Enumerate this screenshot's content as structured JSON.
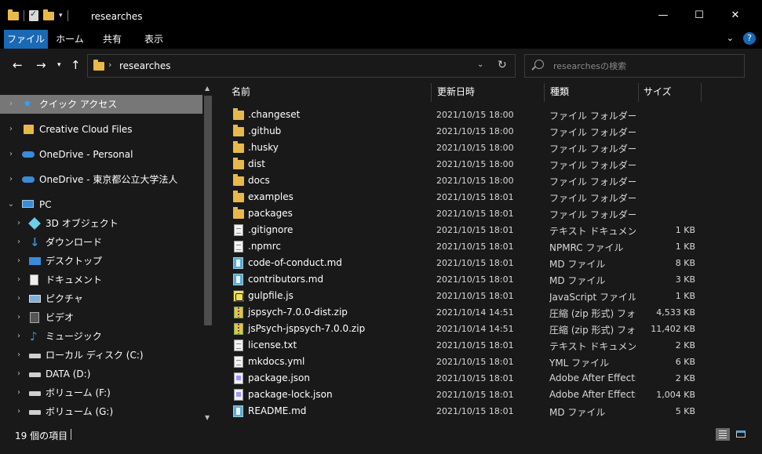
{
  "window": {
    "title": "researches",
    "controls": {
      "minimize": "—",
      "maximize": "☐",
      "close": "✕"
    }
  },
  "ribbon": {
    "tabs": [
      "ファイル",
      "ホーム",
      "共有",
      "表示"
    ],
    "help": "?"
  },
  "address": {
    "crumb": "researches"
  },
  "search": {
    "placeholder": "researchesの検索"
  },
  "nav": {
    "items": [
      {
        "label": "クイック アクセス",
        "icon": "star-icon",
        "selected": true
      },
      {
        "label": "Creative Cloud Files",
        "icon": "creative-cloud-icon"
      },
      {
        "label": "OneDrive - Personal",
        "icon": "onedrive-icon"
      },
      {
        "label": "OneDrive - 東京都公立大学法人",
        "icon": "onedrive-icon"
      },
      {
        "label": "PC",
        "icon": "pc-icon",
        "expanded": true
      },
      {
        "label": "3D オブジェクト",
        "icon": "3d-objects-icon"
      },
      {
        "label": "ダウンロード",
        "icon": "download-icon"
      },
      {
        "label": "デスクトップ",
        "icon": "desktop-icon"
      },
      {
        "label": "ドキュメント",
        "icon": "documents-icon"
      },
      {
        "label": "ピクチャ",
        "icon": "pictures-icon"
      },
      {
        "label": "ビデオ",
        "icon": "videos-icon"
      },
      {
        "label": "ミュージック",
        "icon": "music-icon"
      },
      {
        "label": "ローカル ディスク (C:)",
        "icon": "local-disk-icon"
      },
      {
        "label": "DATA (D:)",
        "icon": "drive-icon"
      },
      {
        "label": "ボリューム (F:)",
        "icon": "drive-icon"
      },
      {
        "label": "ボリューム (G:)",
        "icon": "drive-icon"
      }
    ]
  },
  "list": {
    "headers": {
      "name": "名前",
      "date": "更新日時",
      "type": "種類",
      "size": "サイズ"
    },
    "files": [
      {
        "name": ".changeset",
        "date": "2021/10/15 18:00",
        "type": "ファイル フォルダー",
        "size": "",
        "icon": "folder-icon"
      },
      {
        "name": ".github",
        "date": "2021/10/15 18:00",
        "type": "ファイル フォルダー",
        "size": "",
        "icon": "folder-icon"
      },
      {
        "name": ".husky",
        "date": "2021/10/15 18:00",
        "type": "ファイル フォルダー",
        "size": "",
        "icon": "folder-icon"
      },
      {
        "name": "dist",
        "date": "2021/10/15 18:00",
        "type": "ファイル フォルダー",
        "size": "",
        "icon": "folder-icon"
      },
      {
        "name": "docs",
        "date": "2021/10/15 18:00",
        "type": "ファイル フォルダー",
        "size": "",
        "icon": "folder-icon"
      },
      {
        "name": "examples",
        "date": "2021/10/15 18:01",
        "type": "ファイル フォルダー",
        "size": "",
        "icon": "folder-icon"
      },
      {
        "name": "packages",
        "date": "2021/10/15 18:01",
        "type": "ファイル フォルダー",
        "size": "",
        "icon": "folder-icon"
      },
      {
        "name": ".gitignore",
        "date": "2021/10/15 18:01",
        "type": "テキスト ドキュメント",
        "size": "1 KB",
        "icon": "text-file-icon"
      },
      {
        "name": ".npmrc",
        "date": "2021/10/15 18:01",
        "type": "NPMRC ファイル",
        "size": "1 KB",
        "icon": "text-file-icon"
      },
      {
        "name": "code-of-conduct.md",
        "date": "2021/10/15 18:01",
        "type": "MD ファイル",
        "size": "8 KB",
        "icon": "markdown-file-icon"
      },
      {
        "name": "contributors.md",
        "date": "2021/10/15 18:01",
        "type": "MD ファイル",
        "size": "3 KB",
        "icon": "markdown-file-icon"
      },
      {
        "name": "gulpfile.js",
        "date": "2021/10/15 18:01",
        "type": "JavaScript ファイル",
        "size": "1 KB",
        "icon": "javascript-file-icon"
      },
      {
        "name": "jspsych-7.0.0-dist.zip",
        "date": "2021/10/14 14:51",
        "type": "圧縮 (zip 形式) フォルダー",
        "size": "4,533 KB",
        "icon": "zip-file-icon"
      },
      {
        "name": "jsPsych-jspsych-7.0.0.zip",
        "date": "2021/10/14 14:51",
        "type": "圧縮 (zip 形式) フォルダー",
        "size": "11,402 KB",
        "icon": "zip-file-icon"
      },
      {
        "name": "license.txt",
        "date": "2021/10/15 18:01",
        "type": "テキスト ドキュメント",
        "size": "2 KB",
        "icon": "text-file-icon"
      },
      {
        "name": "mkdocs.yml",
        "date": "2021/10/15 18:01",
        "type": "YML ファイル",
        "size": "6 KB",
        "icon": "text-file-icon"
      },
      {
        "name": "package.json",
        "date": "2021/10/15 18:01",
        "type": "Adobe After Effects",
        "size": "2 KB",
        "icon": "after-effects-file-icon"
      },
      {
        "name": "package-lock.json",
        "date": "2021/10/15 18:01",
        "type": "Adobe After Effects",
        "size": "1,004 KB",
        "icon": "after-effects-file-icon"
      },
      {
        "name": "README.md",
        "date": "2021/10/15 18:01",
        "type": "MD ファイル",
        "size": "5 KB",
        "icon": "markdown-file-icon"
      }
    ]
  },
  "status": {
    "count": "19 個の項目"
  }
}
